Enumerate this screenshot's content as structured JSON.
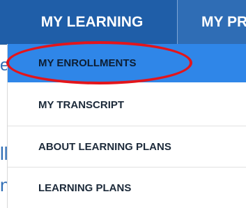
{
  "topnav": {
    "tabs": [
      {
        "label": "MY LEARNING"
      },
      {
        "label": "MY PR"
      }
    ]
  },
  "background": {
    "fragments": [
      "e",
      "ll",
      "n"
    ]
  },
  "dropdown": {
    "items": [
      {
        "label": "MY ENROLLMENTS",
        "active": true
      },
      {
        "label": "MY TRANSCRIPT"
      },
      {
        "label": "ABOUT LEARNING PLANS"
      },
      {
        "label": "LEARNING PLANS"
      }
    ]
  },
  "colors": {
    "nav_bg": "#2f6db5",
    "active_item_bg": "#2f86e8",
    "highlight": "#e3151b"
  }
}
